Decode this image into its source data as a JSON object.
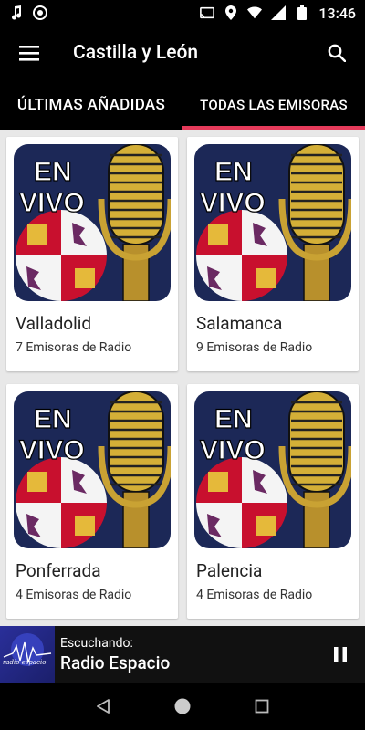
{
  "status_bar": {
    "time": "13:46",
    "icons": [
      "music-note-icon",
      "camera-aperture-icon",
      "cast-icon",
      "location-icon",
      "wifi-icon",
      "signal-icon",
      "battery-icon"
    ]
  },
  "app_bar": {
    "title": "Castilla y León",
    "menu_icon": "hamburger-menu-icon",
    "search_icon": "search-icon"
  },
  "tabs": [
    {
      "label": "ÚLTIMAS AÑADIDAS",
      "active": false
    },
    {
      "label": "TODAS LAS EMISORAS",
      "active": true
    }
  ],
  "cards": [
    {
      "title": "Valladolid",
      "subtitle": "7 Emisoras de Radio",
      "image_text_1": "EN",
      "image_text_2": "VIVO"
    },
    {
      "title": "Salamanca",
      "subtitle": "9 Emisoras de Radio",
      "image_text_1": "EN",
      "image_text_2": "VIVO"
    },
    {
      "title": "Ponferrada",
      "subtitle": "4 Emisoras de Radio",
      "image_text_1": "EN",
      "image_text_2": "VIVO"
    },
    {
      "title": "Palencia",
      "subtitle": "4 Emisoras de Radio",
      "image_text_1": "EN",
      "image_text_2": "VIVO"
    }
  ],
  "player": {
    "label": "Escuchando:",
    "station": "Radio Espacio",
    "thumb_text": "radio espacio",
    "pause_icon": "pause-icon"
  },
  "nav_bar": {
    "icons": [
      "back-icon",
      "home-icon",
      "recents-icon"
    ]
  },
  "colors": {
    "tab_indicator": "#e53a5a",
    "image_bg": "#1c2857",
    "coat_red": "#c8102e",
    "mic_gold": "#d4af37"
  }
}
